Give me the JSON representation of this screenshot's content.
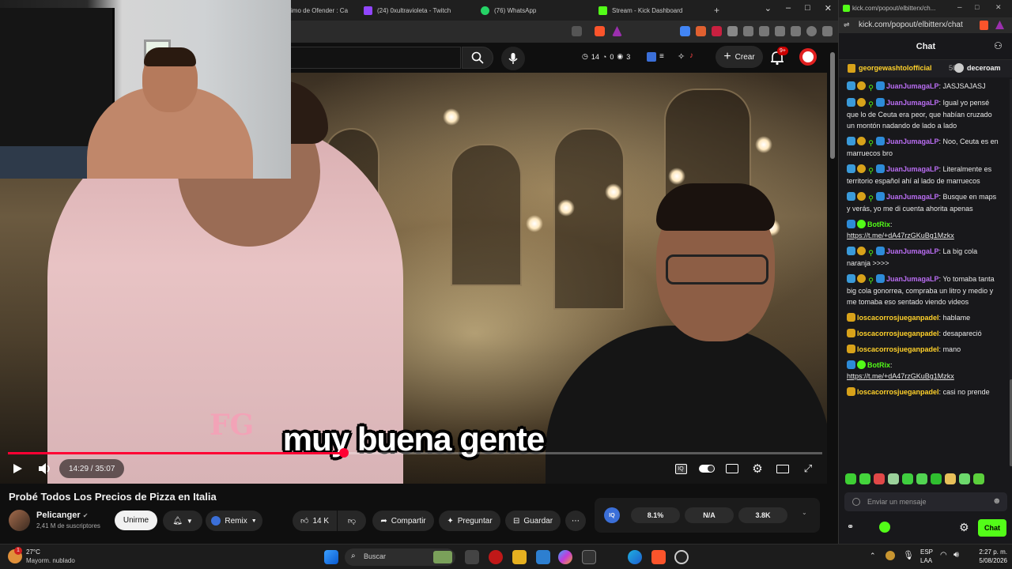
{
  "tabs": [
    {
      "label": "imo de Ofender : Ca",
      "color": "#cc2020"
    },
    {
      "label": "(24) 0xultravioleta - Twitch",
      "color": "#9146ff"
    },
    {
      "label": "(76) WhatsApp",
      "color": "#25d366"
    },
    {
      "label": "Stream - Kick Dashboard",
      "color": "#53fc18"
    }
  ],
  "new_tab": "+",
  "window_controls": {
    "menu": "⌄",
    "minimize": "–",
    "maximize": "□",
    "close": "✕"
  },
  "yt_header": {
    "stats": {
      "views": "14",
      "likes": "0",
      "viewers": "3"
    },
    "create_label": "Crear",
    "notif_badge": "9+"
  },
  "video": {
    "subtitle": "muy buena gente",
    "shirt_logo": "FG",
    "time": "14:29 / 35:07",
    "progress": 0.413,
    "title": "Probé Todos Los Precios de Pizza en Italia"
  },
  "channel": {
    "name": "Pelicanger",
    "verified": "✔",
    "subs": "2,41 M de suscriptores",
    "join_label": "Unirme"
  },
  "actions": {
    "remix": "Remix",
    "likes": "14 K",
    "share": "Compartir",
    "ask": "Preguntar",
    "save": "Guardar",
    "more": "⋯"
  },
  "iq_panel": {
    "logo": "IQ",
    "stat1": "8.1%",
    "stat2": "N/A",
    "stat3": "3.8K"
  },
  "chat_window": {
    "title_url": "kick.com/popout/elbitterx/ch...",
    "url": "kick.com/popout/elbitterx/chat",
    "header_title": "Chat",
    "pinned_user": "georgewashtolofficial",
    "pinned_count": "50",
    "pinned_user2": "deceroam",
    "input_placeholder": "Enviar un mensaje",
    "send_label": "Chat"
  },
  "messages": [
    {
      "user": "JuanJumagaLP",
      "color": "#b96df2",
      "text": "JASJSAJASJ",
      "badges": [
        "sub",
        "gold",
        "green",
        "kick"
      ]
    },
    {
      "user": "JuanJumagaLP",
      "color": "#b96df2",
      "text": "Igual yo pensé que lo de Ceuta era peor, que habían cruzado un montón nadando de lado a lado",
      "badges": [
        "sub",
        "gold",
        "green",
        "kick"
      ]
    },
    {
      "user": "JuanJumagaLP",
      "color": "#b96df2",
      "text": "Noo, Ceuta es en marruecos bro",
      "badges": [
        "sub",
        "gold",
        "green",
        "kick"
      ]
    },
    {
      "user": "JuanJumagaLP",
      "color": "#b96df2",
      "text": "Literalmente es territorio español ahí al lado de marruecos",
      "badges": [
        "sub",
        "gold",
        "green",
        "kick"
      ]
    },
    {
      "user": "JuanJumagaLP",
      "color": "#b96df2",
      "text": "Busque en maps y verás, yo me di cuenta ahorita apenas",
      "badges": [
        "sub",
        "gold",
        "green",
        "kick"
      ]
    },
    {
      "user": "BotRix",
      "color": "#53fc18",
      "text": "https://t.me/+dA47rzGKuBg1Mzkx",
      "badges": [
        "kick",
        "verify"
      ],
      "link": true
    },
    {
      "user": "JuanJumagaLP",
      "color": "#b96df2",
      "text": "La big cola naranja >>>>",
      "badges": [
        "sub",
        "gold",
        "green",
        "kick"
      ]
    },
    {
      "user": "JuanJumagaLP",
      "color": "#b96df2",
      "text": "Yo tomaba tanta big cola gonorrea, compraba un litro y medio y me tomaba eso sentado viendo videos",
      "badges": [
        "sub",
        "gold",
        "green",
        "kick"
      ]
    },
    {
      "user": "loscacorrosjueganpadel",
      "color": "#ffd12b",
      "text": "hablame",
      "badges": [
        "crown"
      ]
    },
    {
      "user": "loscacorrosjueganpadel",
      "color": "#ffd12b",
      "text": "desapareció",
      "badges": [
        "crown"
      ]
    },
    {
      "user": "loscacorrosjueganpadel",
      "color": "#ffd12b",
      "text": "mano",
      "badges": [
        "crown"
      ]
    },
    {
      "user": "BotRix",
      "color": "#53fc18",
      "text": "https://t.me/+dA47rzGKuBg1Mzkx",
      "badges": [
        "kick",
        "verify"
      ],
      "link": true
    },
    {
      "user": "loscacorrosjueganpadel",
      "color": "#ffd12b",
      "text": "casi no prende",
      "badges": [
        "crown"
      ]
    }
  ],
  "emotes": [
    "#3ecf34",
    "#44d43c",
    "#e04848",
    "#9bd19b",
    "#3fce3f",
    "#52d452",
    "#2fbf2f",
    "#e8c05a",
    "#6cd86c",
    "#5bcf3c"
  ],
  "taskbar": {
    "temp": "27°C",
    "weather": "Mayorm. nublado",
    "weather_badge": "1",
    "search": "Buscar",
    "lang1": "ESP",
    "lang2": "LAA",
    "time": "2:27 p. m.",
    "date": "5/08/2026"
  },
  "colors": {
    "yt_red": "#ff0033",
    "kick_green": "#53fc18"
  }
}
